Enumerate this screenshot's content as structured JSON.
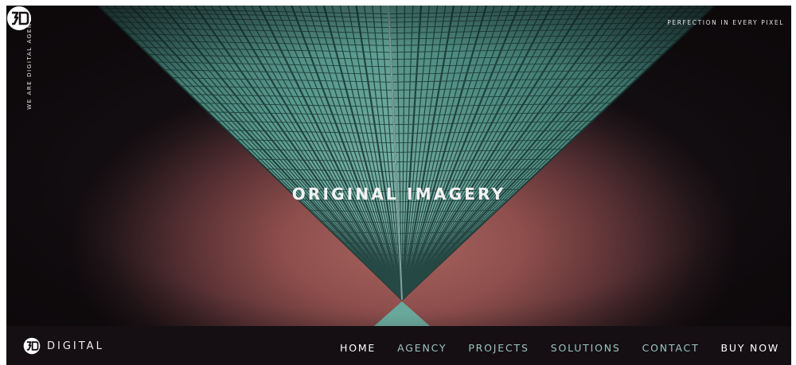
{
  "hero": {
    "side_tagline": "WE ARE DIGITAL AGENCY",
    "top_tagline": "PERFECTION IN EVERY PIXEL",
    "logo_icon": "3d-monogram-logo-icon",
    "title": "ORIGINAL IMAGERY",
    "image": "upward-view-of-skyscrapers-image"
  },
  "brand": {
    "logo_icon": "3d-monogram-logo-icon",
    "name": "DIGITAL"
  },
  "nav": {
    "items": [
      {
        "label": "HOME",
        "active": true
      },
      {
        "label": "AGENCY",
        "active": false
      },
      {
        "label": "PROJECTS",
        "active": false
      },
      {
        "label": "SOLUTIONS",
        "active": false
      },
      {
        "label": "CONTACT",
        "active": false
      },
      {
        "label": "BUY NOW",
        "active": false
      }
    ]
  },
  "colors": {
    "background": "#150f13",
    "building": "#5f9f95",
    "sky": "#a8645f",
    "nav_text": "#9cc4bc",
    "nav_active": "#ffffff"
  }
}
